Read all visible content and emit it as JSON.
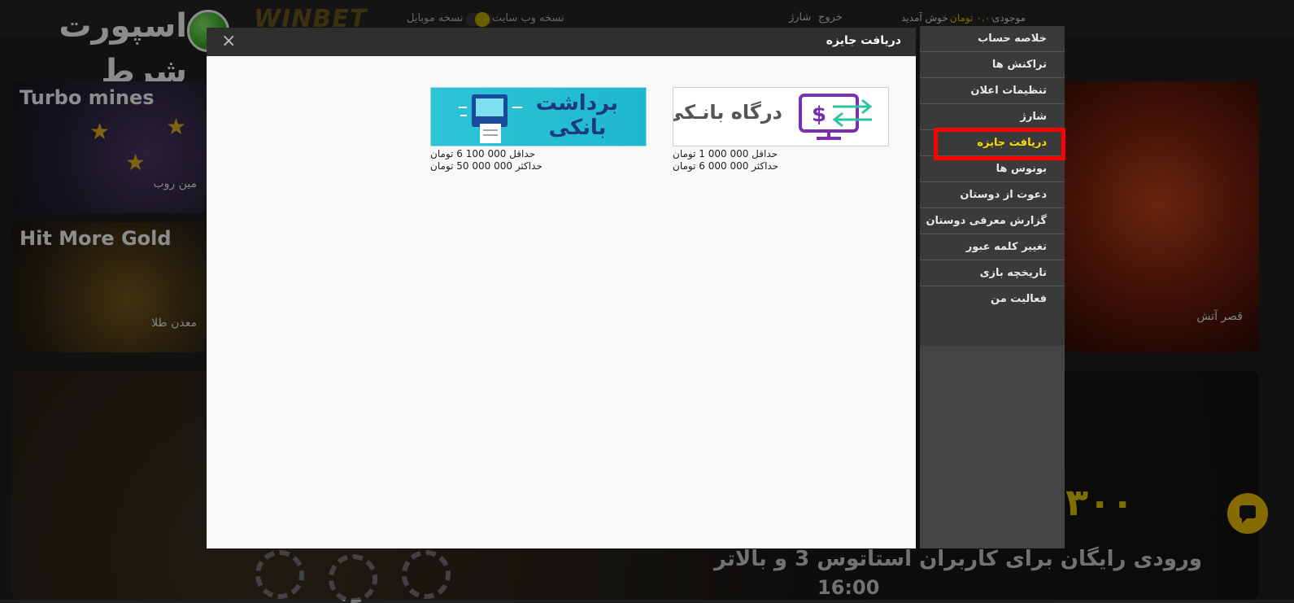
{
  "header": {
    "brand_text": "اسپورت شرط",
    "winbet_logo": "WINBET",
    "web_version_label": "نسخه وب سایت",
    "mobile_version_label": "نسخه موبایل",
    "logout_label": "خروج",
    "charge_label": "شارژ",
    "welcome_label": "خوش آمدید",
    "currency_label": "تومان",
    "balance_amount": "۰.۰۰",
    "balance_label": "موجودی"
  },
  "games": [
    {
      "title": "Turbo mines",
      "subtitle": "مین روب"
    },
    {
      "title": "Hit More Gold",
      "subtitle": "معدن طلا"
    },
    {
      "title": "",
      "subtitle": "قصر آتش"
    }
  ],
  "banner": {
    "amount_text": "۳۰۰",
    "line1": "ورودی رایگان برای کاربران استاتوس 3 و بالاتر",
    "line2": "16:00"
  },
  "side_menu": {
    "items": [
      {
        "label": "خلاصه حساب",
        "active": false
      },
      {
        "label": "تراکنش ها",
        "active": false
      },
      {
        "label": "تنظیمات اعلان",
        "active": false
      },
      {
        "label": "شارژ",
        "active": false
      },
      {
        "label": "دریافت جایزه",
        "active": true
      },
      {
        "label": "بونوس ها",
        "active": false
      },
      {
        "label": "دعوت از دوستان",
        "active": false
      },
      {
        "label": "گزارش معرفی دوستان",
        "active": false
      },
      {
        "label": "تغییر کلمه عبور",
        "active": false
      },
      {
        "label": "تاریخچه بازی",
        "active": false
      },
      {
        "label": "فعالیت من",
        "active": false
      }
    ]
  },
  "modal": {
    "title": "دریافت جایزه",
    "close_icon": "×",
    "options": [
      {
        "banner_text": "درگاه بانـکی",
        "min_text": "حداقل 000 000 1 تومان",
        "max_text": "حداکثر 000 000 6 تومان",
        "icon": "monitor-dollar-icon"
      },
      {
        "banner_text": "برداشت بانکی",
        "min_text": "حداقل 000 100 6 تومان",
        "max_text": "حداکثر 000 000 50 تومان",
        "icon": "atm-withdraw-icon"
      }
    ]
  },
  "colors": {
    "accent_yellow": "#f4e000",
    "highlight_red": "#ff0000",
    "gateway_purple": "#7a2fb0",
    "gateway_teal": "#2ec4a0",
    "bank_cyan": "#2ec4d6"
  }
}
